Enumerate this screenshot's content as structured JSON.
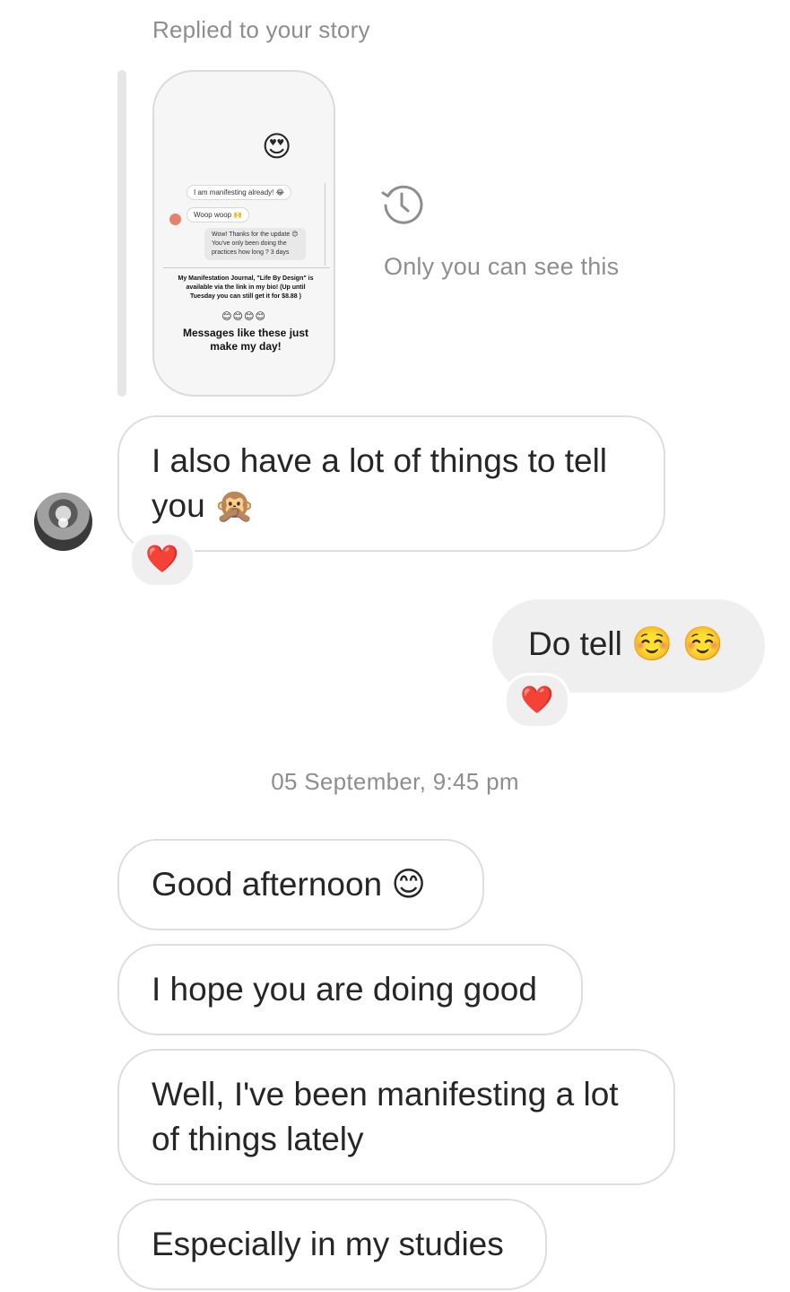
{
  "story_reply": {
    "label": "Replied to your story",
    "preview": {
      "emoji": "😍",
      "messages": [
        {
          "text": "I am manifesting already! 😂",
          "side": "in"
        },
        {
          "text": "Woop woop 🙌",
          "side": "in"
        },
        {
          "text": "Wow! Thanks for the update 😊\nYou've only been doing the\npractices how long ? 3 days",
          "side": "out"
        }
      ],
      "caption": "My Manifestation Journal, \"Life By Design\" is available via the link in my bio! (Up until Tuesday you can still get it for $8.88 )",
      "emoji_row": "😊😊😊😊",
      "headline": "Messages like these just make my day!"
    },
    "private_note": "Only you can see this",
    "history_icon": "history-clock-icon"
  },
  "messages": [
    {
      "side": "incoming",
      "text": "I also have a lot of things to tell you 🙊",
      "reaction": "❤️"
    },
    {
      "side": "outgoing",
      "text": "Do tell ☺️ ☺️",
      "reaction": "❤️"
    }
  ],
  "date_separator": "05 September, 9:45 pm",
  "later_messages": [
    {
      "side": "incoming",
      "text": "Good afternoon 😊"
    },
    {
      "side": "incoming",
      "text": "I hope you are doing good"
    },
    {
      "side": "incoming",
      "text": "Well, I've been manifesting a lot of things lately"
    },
    {
      "side": "incoming",
      "text": "Especially in my studies"
    }
  ],
  "colors": {
    "incoming_bubble_border": "#dedede",
    "outgoing_bubble_bg": "#efefef",
    "secondary_text": "#8e8e8e",
    "primary_text": "#262626",
    "heart": "#e6192b"
  }
}
